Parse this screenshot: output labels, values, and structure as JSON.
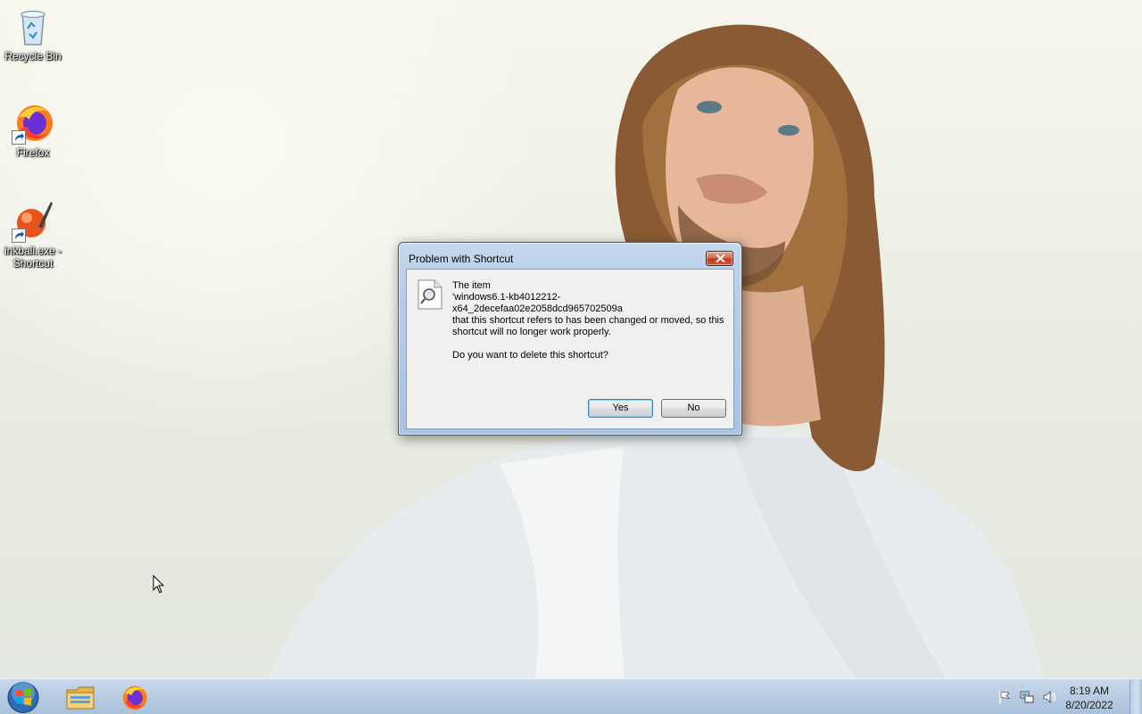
{
  "desktop": {
    "icons": [
      {
        "label": "Recycle Bin",
        "icon": "recycle-bin-icon"
      },
      {
        "label": "Firefox",
        "icon": "firefox-icon"
      },
      {
        "label": "inkball.exe - Shortcut",
        "icon": "inkball-icon"
      }
    ]
  },
  "dialog": {
    "title": "Problem with Shortcut",
    "message_line1": "The item",
    "message_line2": "'windows6.1-kb4012212-x64_2decefaa02e2058dcd965702509a",
    "message_line3": "that this shortcut refers to has been changed or moved, so this shortcut will no longer work properly.",
    "question": "Do you want to delete this shortcut?",
    "yes_label": "Yes",
    "no_label": "No",
    "icon": "document-search-icon"
  },
  "taskbar": {
    "start": "windows-start-orb",
    "pinned": [
      "file-explorer-icon",
      "firefox-icon"
    ],
    "tray_icons": [
      "action-center-flag-icon",
      "network-icon",
      "volume-icon"
    ],
    "time": "8:19 AM",
    "date": "8/20/2022"
  },
  "colors": {
    "taskbar": "#b7cce2",
    "dialog_frame": "#b5cde8",
    "close_button": "#c0391d",
    "default_button_border": "#3c7fb1"
  }
}
